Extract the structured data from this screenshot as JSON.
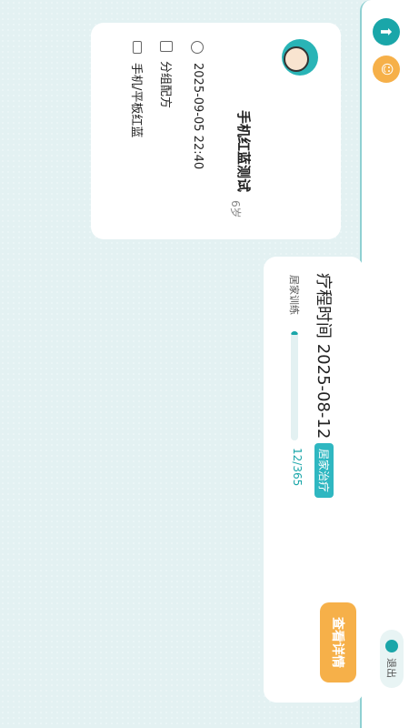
{
  "rail": {
    "top_icon": "upload-icon",
    "second_icon": "face-icon",
    "exit_label": "退出"
  },
  "profile": {
    "name": "手机红蓝测试",
    "age": "6岁",
    "datetime": "2025-09-05 22:40",
    "config": "分组配方",
    "device": "手机/平板红蓝"
  },
  "course": {
    "title": "疗程时间 2025-08-12",
    "badge": "居家治疗",
    "training_label": "居家训练",
    "progress_fraction": 0.033,
    "progress_text": "12/365",
    "detail_button": "查看详情"
  },
  "colors": {
    "accent": "#1aa6a9",
    "button": "#f6b049",
    "badge": "#2fb7c1"
  }
}
